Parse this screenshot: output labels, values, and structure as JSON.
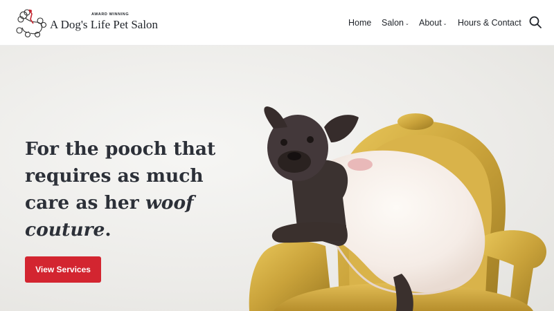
{
  "header": {
    "logo": {
      "tagline": "AWARD WINNING",
      "name": "A Dog's Life Pet Salon",
      "icon": "poodle-logo-icon"
    },
    "nav": [
      {
        "label": "Home",
        "has_dropdown": false
      },
      {
        "label": "Salon",
        "has_dropdown": true
      },
      {
        "label": "About",
        "has_dropdown": true
      },
      {
        "label": "Hours & Contact",
        "has_dropdown": false
      }
    ],
    "chevron": "⌄",
    "search_icon": "search-icon"
  },
  "hero": {
    "title_line": "For the pooch that requires as much care as her",
    "title_emphasis": "woof couture",
    "title_end": ".",
    "cta_label": "View Services",
    "image": "french-bulldog-in-dress-on-gold-chair",
    "colors": {
      "accent": "#d32530",
      "text": "#2c3038",
      "gold": "#c9a23a"
    }
  }
}
